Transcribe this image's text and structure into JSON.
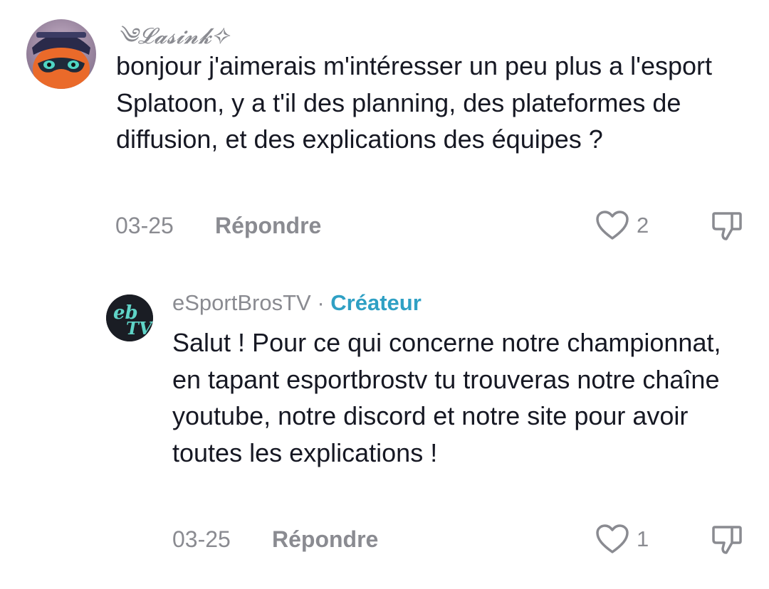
{
  "comments": [
    {
      "username": "༄𝓛𝓪𝓼𝓲𝓷𝓴✧",
      "text": "bonjour j'aimerais m'intéresser un peu plus a l'esport Splatoon, y a t'il des planning, des plateformes de diffusion, et des explications des équipes ?",
      "date": "03-25",
      "reply_label": "Répondre",
      "like_count": "2",
      "avatar_icon": "squid-character-avatar"
    },
    {
      "username": "eSportBrosTV",
      "separator": "·",
      "badge": "Créateur",
      "text": "Salut ! Pour ce qui concerne notre championnat, en tapant esportbrostv tu trouveras notre chaîne youtube, notre discord et notre site pour avoir toutes les explications !",
      "date": "03-25",
      "reply_label": "Répondre",
      "like_count": "1",
      "avatar_icon": "ebtv-logo-avatar",
      "avatar_text_top": "eb",
      "avatar_text_bottom": "TV"
    }
  ],
  "colors": {
    "meta_gray": "#8a8b91",
    "creator_accent": "#2fa0c4",
    "text": "#161823"
  }
}
